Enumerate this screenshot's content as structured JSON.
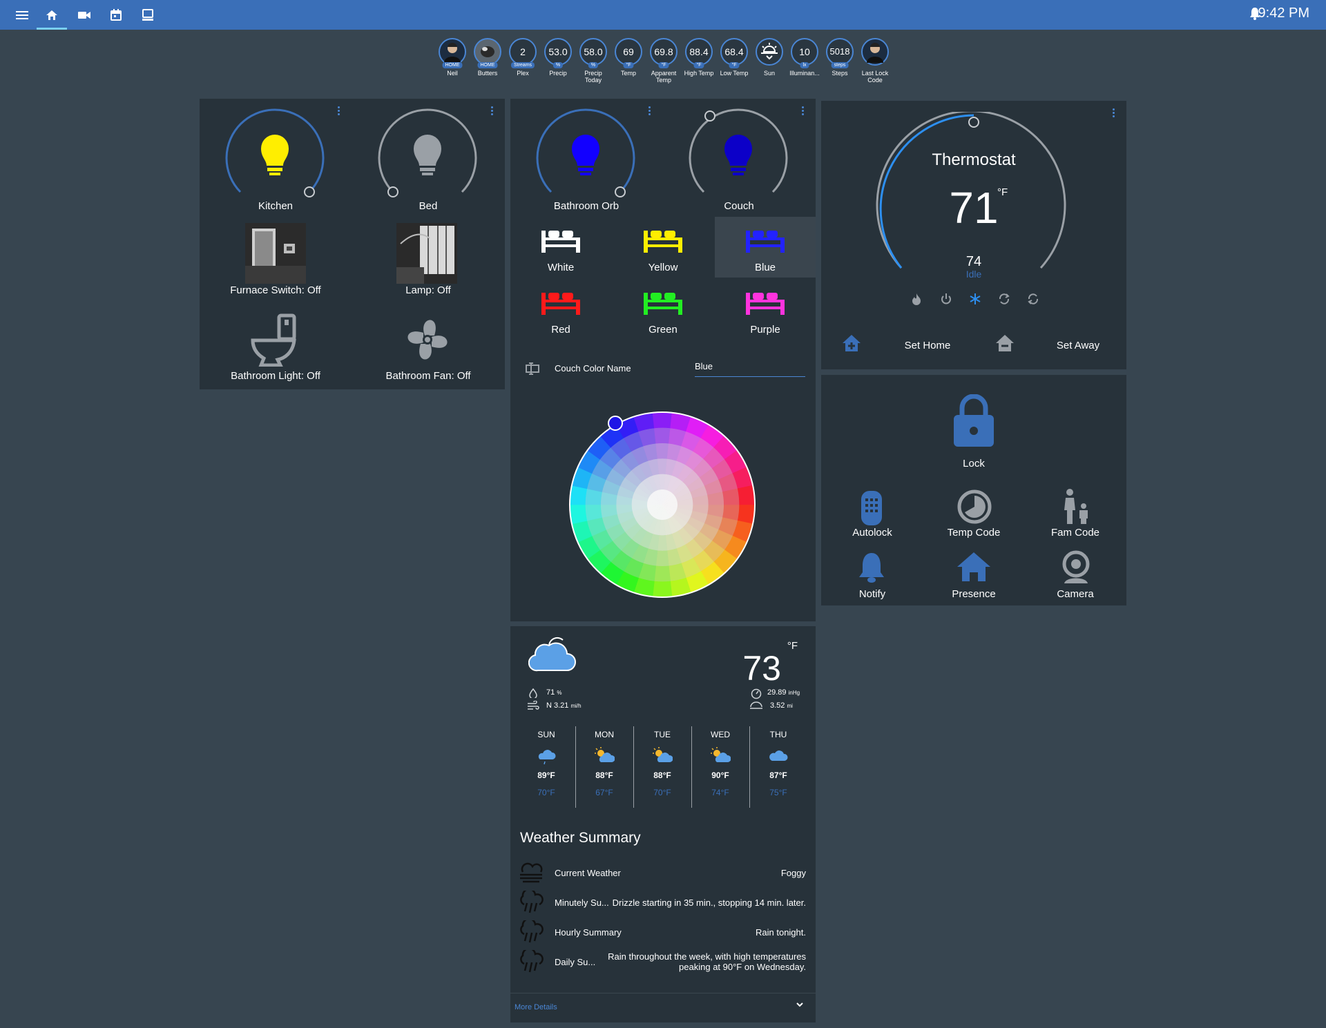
{
  "colors": {
    "topbar": "#3a6fb8",
    "background": "#374550",
    "card": "#27323a",
    "accent": "#4a86d4"
  },
  "topbar": {
    "time": "9:42 PM"
  },
  "badges": [
    {
      "value": "",
      "unit": "HOME",
      "label": "Neil",
      "type": "avatar"
    },
    {
      "value": "",
      "unit": "HOME",
      "label": "Butters",
      "type": "avatar"
    },
    {
      "value": "2",
      "unit": "Streams",
      "label": "Plex"
    },
    {
      "value": "53.0",
      "unit": "%",
      "label": "Precip"
    },
    {
      "value": "58.0",
      "unit": "%",
      "label": "Precip Today"
    },
    {
      "value": "69",
      "unit": "°F",
      "label": "Temp"
    },
    {
      "value": "69.8",
      "unit": "°F",
      "label": "Apparent Temp"
    },
    {
      "value": "88.4",
      "unit": "°F",
      "label": "High Temp"
    },
    {
      "value": "68.4",
      "unit": "°F",
      "label": "Low Temp"
    },
    {
      "value": "",
      "unit": "",
      "label": "Sun",
      "type": "sun"
    },
    {
      "value": "10",
      "unit": "lx",
      "label": "Illuminan..."
    },
    {
      "value": "5018",
      "unit": "steps",
      "label": "Steps"
    },
    {
      "value": "",
      "unit": "",
      "label": "Last Lock Code",
      "type": "avatar"
    }
  ],
  "lights": {
    "kitchen": {
      "label": "Kitchen",
      "color": "#ffee00",
      "level": 1.0
    },
    "bed": {
      "label": "Bed",
      "color": "#9aa0a6",
      "level": 0.0
    },
    "furnace": {
      "label": "Furnace Switch: Off"
    },
    "lamp": {
      "label": "Lamp: Off"
    },
    "bath_light": {
      "label": "Bathroom Light: Off"
    },
    "bath_fan": {
      "label": "Bathroom Fan: Off"
    }
  },
  "colorlights": {
    "orb": {
      "label": "Bathroom Orb",
      "color": "#1200ff",
      "level": 1.0
    },
    "couch": {
      "label": "Couch",
      "color": "#0c00c8",
      "level": 0.0
    }
  },
  "scenes": [
    {
      "label": "White",
      "color": "#ffffff"
    },
    {
      "label": "Yellow",
      "color": "#ffee00"
    },
    {
      "label": "Blue",
      "color": "#2222ff",
      "selected": true
    },
    {
      "label": "Red",
      "color": "#ff1a1a"
    },
    {
      "label": "Green",
      "color": "#22ee22"
    },
    {
      "label": "Purple",
      "color": "#ff33dd"
    }
  ],
  "couch_color": {
    "label": "Couch Color Name",
    "value": "Blue"
  },
  "thermostat": {
    "title": "Thermostat",
    "current": "71",
    "unit": "°F",
    "target": "74",
    "state": "Idle",
    "set_home": "Set Home",
    "set_away": "Set Away"
  },
  "lock_panel": {
    "lock": "Lock",
    "autolock": "Autolock",
    "temp_code": "Temp Code",
    "fam_code": "Fam Code",
    "notify": "Notify",
    "presence": "Presence",
    "camera": "Camera"
  },
  "weather": {
    "temp": "73",
    "unit": "°F",
    "humidity": "71",
    "humidity_unit": "%",
    "wind": "N 3.21",
    "wind_unit": "mi/h",
    "pressure": "29.89",
    "pressure_unit": "inHg",
    "visibility": "3.52",
    "visibility_unit": "mi",
    "forecast": [
      {
        "day": "SUN",
        "high": "89°F",
        "low": "70°F"
      },
      {
        "day": "MON",
        "high": "88°F",
        "low": "67°F"
      },
      {
        "day": "TUE",
        "high": "88°F",
        "low": "70°F"
      },
      {
        "day": "WED",
        "high": "90°F",
        "low": "74°F"
      },
      {
        "day": "THU",
        "high": "87°F",
        "low": "75°F"
      }
    ]
  },
  "summary": {
    "title": "Weather Summary",
    "rows": [
      {
        "label": "Current Weather",
        "value": "Foggy"
      },
      {
        "label": "Minutely Su...",
        "value": "Drizzle starting in 35 min., stopping 14 min. later."
      },
      {
        "label": "Hourly Summary",
        "value": "Rain tonight."
      },
      {
        "label": "Daily Su...",
        "value": "Rain throughout the week, with high temperatures",
        "value2": "peaking at 90°F on Wednesday."
      }
    ],
    "more": "More Details"
  }
}
